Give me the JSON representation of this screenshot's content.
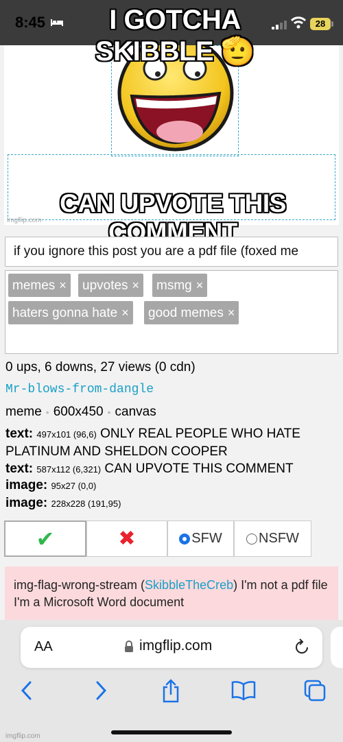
{
  "status_bar": {
    "time": "8:45",
    "battery": "28"
  },
  "meme": {
    "top_caption": "I GOTCHA SKIBBLE 🫡",
    "bottom_caption": "CAN UPVOTE THIS COMMENT",
    "watermark": "imgflip.com"
  },
  "title_input": {
    "value": "if you ignore this post you are a pdf file (foxed me"
  },
  "tags": [
    {
      "label": "memes"
    },
    {
      "label": "upvotes"
    },
    {
      "label": "msmg"
    },
    {
      "label": "haters gonna hate"
    },
    {
      "label": "good memes"
    }
  ],
  "tag_remove_symbol": "×",
  "stats": {
    "text": "0 ups, 6 downs, 27 views (0 cdn)"
  },
  "username": "Mr-blows-from-dangle",
  "meme_info": {
    "type": "meme",
    "size": "600x450",
    "mode": "canvas",
    "separator": "•"
  },
  "layers": [
    {
      "kind": "text",
      "dims": "497x101 (96,6)",
      "content": "ONLY REAL PEOPLE WHO HATE"
    },
    {
      "kind": "",
      "dims": "",
      "content": "PLATINUM AND SHELDON COOPER"
    },
    {
      "kind": "text",
      "dims": "587x112 (6,321)",
      "content": "CAN UPVOTE THIS COMMENT"
    },
    {
      "kind": "image",
      "dims": "95x27 (0,0)",
      "content": ""
    },
    {
      "kind": "image",
      "dims": "228x228 (191,95)",
      "content": ""
    }
  ],
  "layer_colon": ":",
  "moderation": {
    "approve_icon": "✔",
    "disapprove_icon": "✖",
    "sfw_label": "SFW",
    "nsfw_label": "NSFW",
    "sfw_selected": true
  },
  "notice": {
    "prefix": "img-flag-wrong-stream (",
    "link": "SkibbleTheCreb",
    "suffix": ") I'm not a pdf file I'm a Microsoft Word document"
  },
  "browser": {
    "text_size": "AA",
    "url": "imgflip.com"
  },
  "credit": "imgflip.com",
  "colors": {
    "link": "#1aa0c8",
    "notice_bg": "#fbd9dc",
    "approve": "#2eb84b",
    "disapprove": "#e8232f",
    "status_bar": "#3b3b3b"
  }
}
